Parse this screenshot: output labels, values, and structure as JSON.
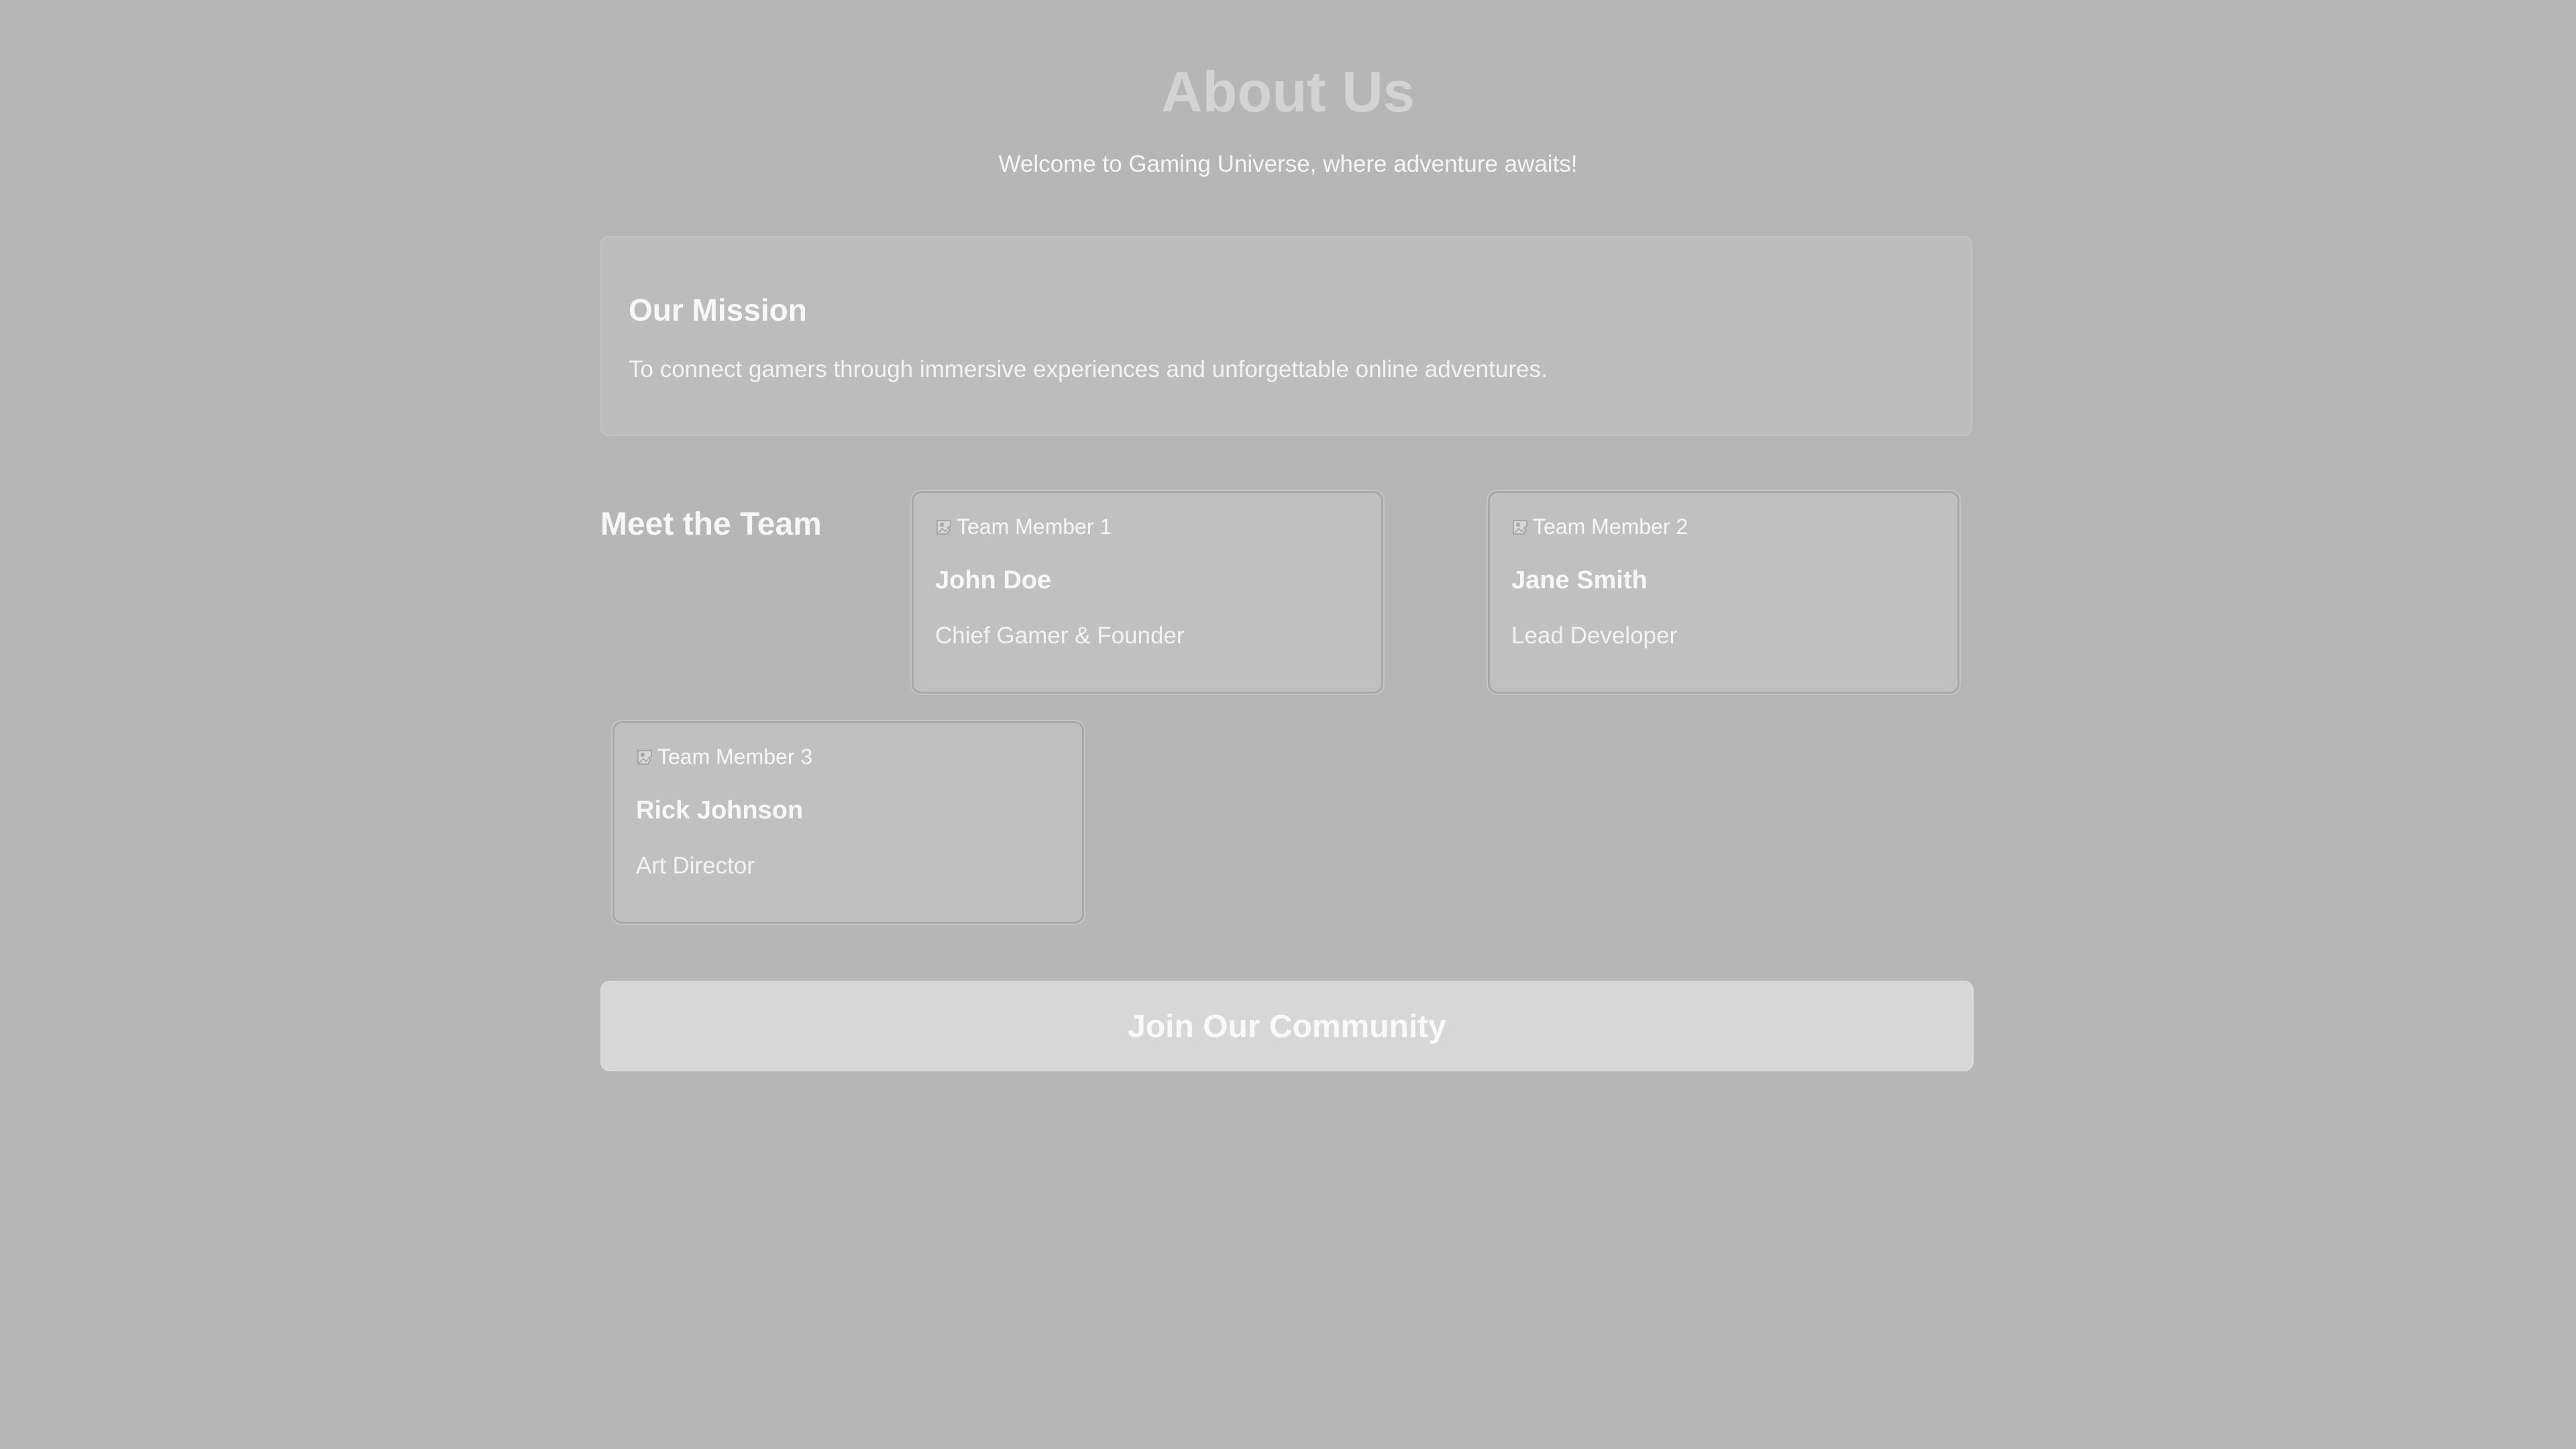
{
  "header": {
    "title": "About Us",
    "subtitle": "Welcome to Gaming Universe, where adventure awaits!"
  },
  "mission": {
    "heading": "Our Mission",
    "text": "To connect gamers through immersive experiences and unforgettable online adventures."
  },
  "team": {
    "heading": "Meet the Team",
    "members": [
      {
        "image_alt": "Team Member 1",
        "name": "John Doe",
        "role": "Chief Gamer & Founder"
      },
      {
        "image_alt": "Team Member 2",
        "name": "Jane Smith",
        "role": "Lead Developer"
      },
      {
        "image_alt": "Team Member 3",
        "name": "Rick Johnson",
        "role": "Art Director"
      }
    ]
  },
  "cta": {
    "label": "Join Our Community"
  },
  "icons": {
    "member_image": "broken-image-icon"
  },
  "colors": {
    "background": "#b6b6b6",
    "title": "#d3d3d3",
    "text": "#f5f5f5",
    "button": "#d7d7d7"
  }
}
